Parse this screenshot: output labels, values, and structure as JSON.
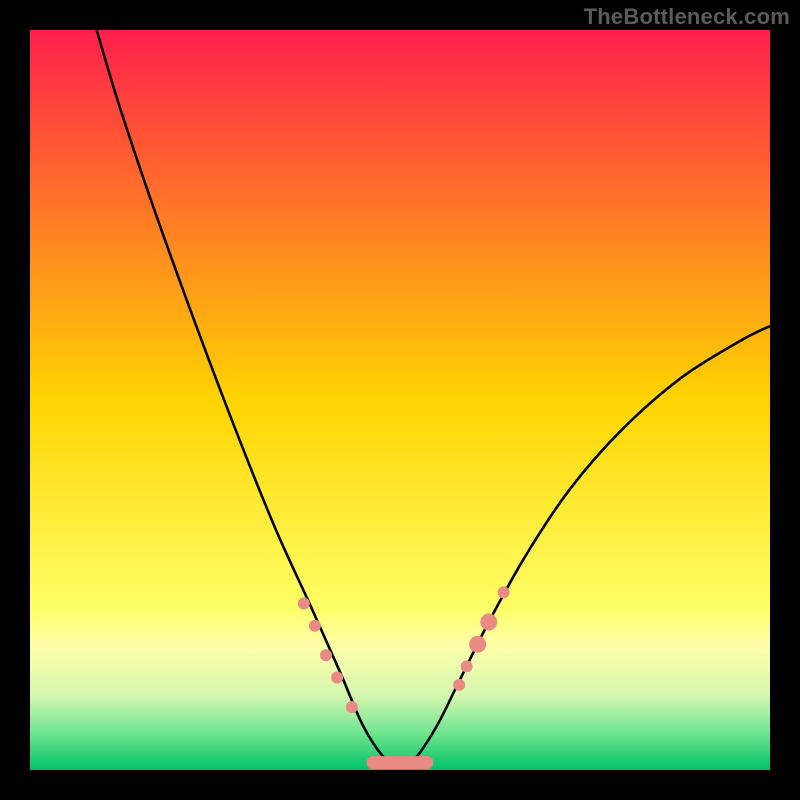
{
  "watermark": {
    "text": "TheBottleneck.com"
  },
  "chart_data": {
    "type": "line",
    "title": "",
    "xlabel": "",
    "ylabel": "",
    "xlim": [
      0,
      100
    ],
    "ylim": [
      0,
      100
    ],
    "grid": false,
    "legend": false,
    "background_gradient": {
      "stops": [
        {
          "offset": 0.0,
          "color": "#ff1f4b"
        },
        {
          "offset": 0.5,
          "color": "#ffd400"
        },
        {
          "offset": 0.78,
          "color": "#ffff66"
        },
        {
          "offset": 0.83,
          "color": "#ffffa8"
        },
        {
          "offset": 0.9,
          "color": "#d4f7b0"
        },
        {
          "offset": 0.95,
          "color": "#6fe590"
        },
        {
          "offset": 1.0,
          "color": "#00c268"
        }
      ]
    },
    "series": [
      {
        "name": "bottleneck-curve",
        "stroke": "#000000",
        "x": [
          9,
          12,
          16,
          21,
          27,
          33,
          38,
          42,
          45,
          48,
          50,
          52,
          55,
          58,
          62,
          67,
          73,
          80,
          88,
          96,
          100
        ],
        "y": [
          100,
          90,
          78,
          64,
          48,
          33,
          22,
          13,
          6,
          1.5,
          0.5,
          1.5,
          6,
          12,
          20,
          29,
          38,
          46,
          53,
          58,
          60
        ]
      }
    ],
    "markers": {
      "name": "highlight-dots",
      "color": "#e98b84",
      "radius_small": 6,
      "radius_large": 8.5,
      "points": [
        {
          "x": 37.0,
          "y": 22.5,
          "r": "s"
        },
        {
          "x": 38.5,
          "y": 19.5,
          "r": "s"
        },
        {
          "x": 40.0,
          "y": 15.5,
          "r": "s"
        },
        {
          "x": 41.5,
          "y": 12.5,
          "r": "s"
        },
        {
          "x": 43.5,
          "y": 8.5,
          "r": "s"
        },
        {
          "x": 59.0,
          "y": 14.0,
          "r": "s"
        },
        {
          "x": 60.5,
          "y": 17.0,
          "r": "l"
        },
        {
          "x": 62.0,
          "y": 20.0,
          "r": "l"
        },
        {
          "x": 64.0,
          "y": 24.0,
          "r": "s"
        },
        {
          "x": 58.0,
          "y": 11.5,
          "r": "s"
        }
      ]
    },
    "flat_segment": {
      "name": "base-flat",
      "color": "#e98b84",
      "x0": 45.5,
      "x1": 54.5,
      "y": 1.0,
      "thickness": 13
    }
  }
}
